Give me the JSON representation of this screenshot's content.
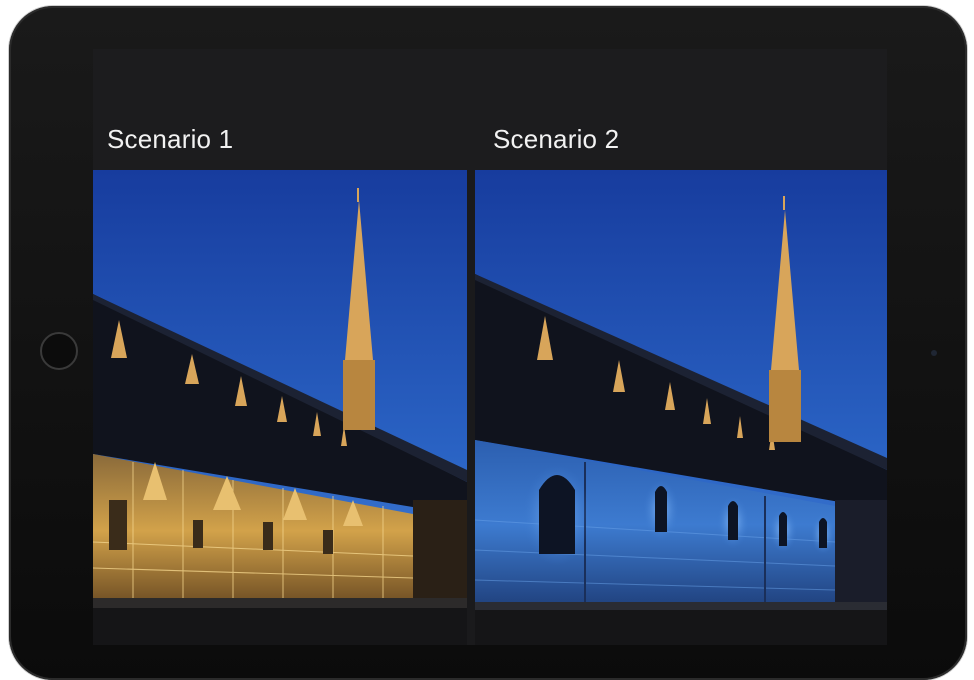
{
  "screen": {
    "scenarios": [
      {
        "label": "Scenario 1",
        "lighting": "colored facade projection"
      },
      {
        "label": "Scenario 2",
        "lighting": "blue wash lighting"
      }
    ]
  },
  "colors": {
    "sky_top": "#1a3fa0",
    "sky_bottom": "#3b7ad6",
    "roof": "#12141f",
    "spire_gold": "#d8a55a",
    "facade_warm": "#c99a3a",
    "facade_blue": "#3f7fd6"
  }
}
